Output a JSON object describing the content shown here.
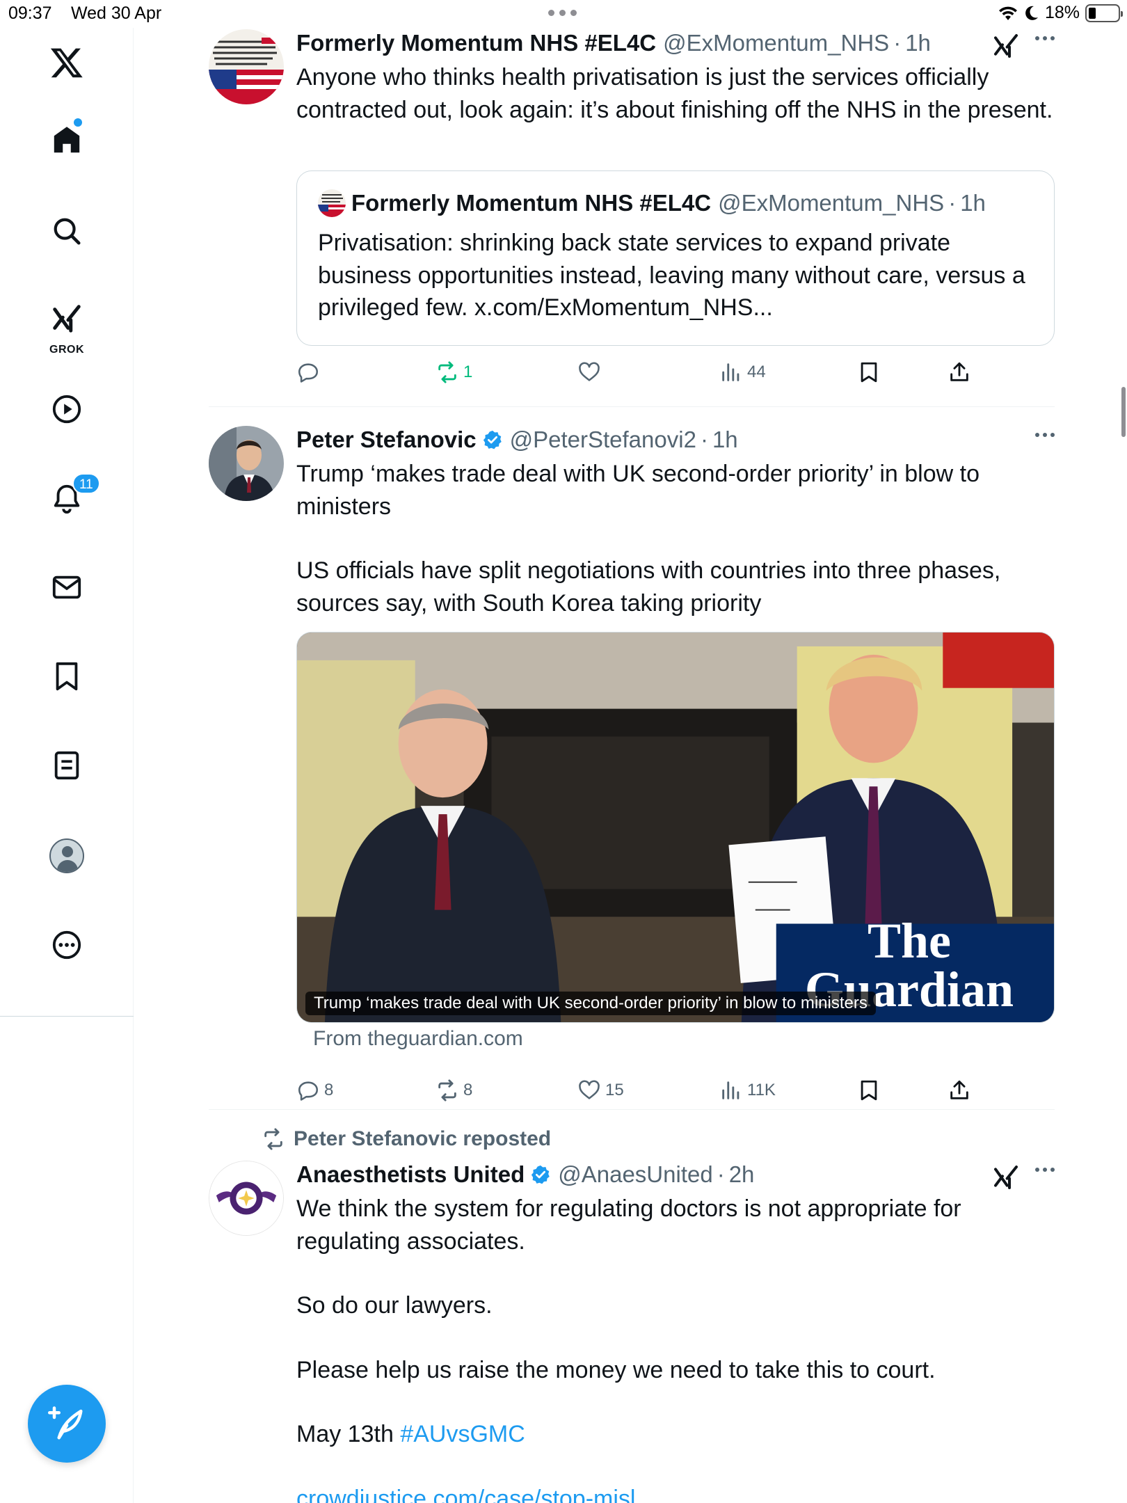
{
  "status_bar": {
    "time": "09:37",
    "date": "Wed 30 Apr",
    "battery": "18%"
  },
  "sidebar": {
    "items": [
      {
        "name": "home"
      },
      {
        "name": "explore"
      },
      {
        "name": "grok",
        "label": "GROK"
      },
      {
        "name": "video"
      },
      {
        "name": "notifications",
        "badge": "11"
      },
      {
        "name": "messages"
      },
      {
        "name": "bookmarks"
      },
      {
        "name": "lists"
      },
      {
        "name": "profile"
      },
      {
        "name": "more"
      }
    ]
  },
  "tweets": [
    {
      "author": "Formerly Momentum NHS #EL4C",
      "handle": "@ExMomentum_NHS",
      "sep": "·",
      "time": "1h",
      "text": [
        "Anyone who thinks health privatisation is just the services officially contracted out, look again: it’s about finishing off the NHS in the present."
      ],
      "quote": {
        "author": "Formerly Momentum NHS #EL4C",
        "handle": "@ExMomentum_NHS",
        "time": "1h",
        "text": "Privatisation: shrinking back state services to expand private business opportunities instead, leaving many without care, versus a privileged few. x.com/ExMomentum_NHS..."
      },
      "stats": {
        "replies": "",
        "reposts": "1",
        "likes": "",
        "views": "44"
      }
    },
    {
      "author": "Peter Stefanovic",
      "handle": "@PeterStefanovi2",
      "sep": "·",
      "time": "1h",
      "text_a": "Trump ‘makes trade deal with UK second-order priority’ in blow to ministers",
      "text_b": "US officials have split negotiations with countries into three phases, sources say, with South Korea taking priority",
      "card": {
        "caption": "Trump ‘makes trade deal with UK second-order priority’ in blow to ministers",
        "source": "From theguardian.com",
        "logo_line1": "The",
        "logo_line2": "Guardian"
      },
      "stats": {
        "replies": "8",
        "reposts": "8",
        "likes": "15",
        "views": "11K"
      }
    },
    {
      "reposted_by": "Peter Stefanovic reposted",
      "author": "Anaesthetists United",
      "handle": "@AnaesUnited",
      "sep": "·",
      "time": "2h",
      "p1": "We think the system for regulating doctors is not appropriate for regulating associates.",
      "p2": "So do our lawyers.",
      "p3": "Please help us raise the money we need to take this to court.",
      "p4_prefix": "May 13th ",
      "hashtag": "#AUvsGMC",
      "link": "crowdjustice.com/case/stop-misl"
    }
  ]
}
